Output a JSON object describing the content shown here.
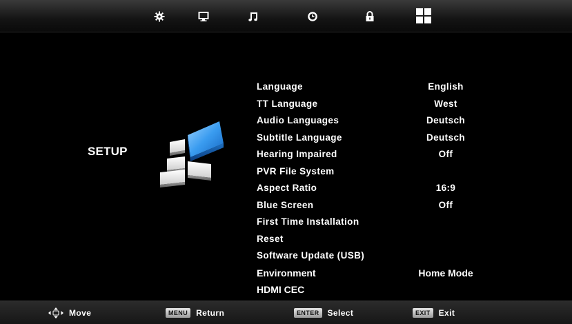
{
  "tabs": [
    {
      "name": "picture",
      "icon": "gear-icon"
    },
    {
      "name": "display",
      "icon": "monitor-icon"
    },
    {
      "name": "sound",
      "icon": "music-note-icon"
    },
    {
      "name": "time",
      "icon": "clock-icon"
    },
    {
      "name": "lock",
      "icon": "lock-icon"
    },
    {
      "name": "setup",
      "icon": "grid-icon",
      "active": true
    }
  ],
  "section": {
    "title": "SETUP",
    "logo_icon": "setup-blocks-icon"
  },
  "menu": {
    "items": [
      {
        "label": "Language",
        "value": "English"
      },
      {
        "label": "TT Language",
        "value": "West"
      },
      {
        "label": "Audio Languages",
        "value": "Deutsch"
      },
      {
        "label": "Subtitle Language",
        "value": "Deutsch"
      },
      {
        "label": "Hearing Impaired",
        "value": "Off"
      },
      {
        "label": "PVR File System",
        "value": ""
      },
      {
        "label": "Aspect Ratio",
        "value": "16:9"
      },
      {
        "label": "Blue Screen",
        "value": "Off"
      },
      {
        "label": "First Time Installation",
        "value": ""
      },
      {
        "label": "Reset",
        "value": ""
      },
      {
        "label": "Software Update (USB)",
        "value": ""
      },
      {
        "label": "Environment",
        "value": "Home Mode"
      },
      {
        "label": "HDMI CEC",
        "value": ""
      }
    ]
  },
  "footer": {
    "move": {
      "icon": "dpad-arrows-icon",
      "label": "Move"
    },
    "return": {
      "key": "MENU",
      "label": "Return"
    },
    "select": {
      "key": "ENTER",
      "label": "Select"
    },
    "exit": {
      "key": "EXIT",
      "label": "Exit"
    }
  },
  "colors": {
    "background": "#000000",
    "text": "#ffffff",
    "accent_blue": "#2a8fe0"
  }
}
